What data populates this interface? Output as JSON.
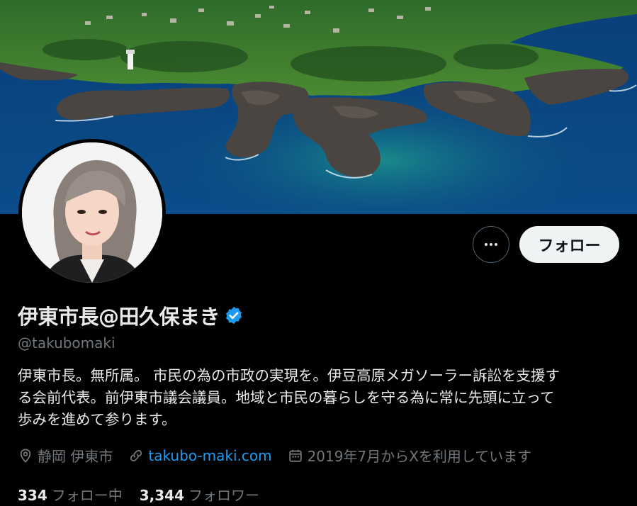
{
  "profile": {
    "display_name": "伊東市長@田久保まき",
    "handle": "@takubomaki",
    "bio_lines": [
      "伊東市長。無所属。 市民の為の市政の実現を。伊豆高原メガソーラー訴訟を支援す",
      "る会前代表。前伊東市議会議員。地域と市民の暮らしを守る為に常に先頭に立って",
      "歩みを進めて参ります。"
    ],
    "location": "静岡 伊東市",
    "website": "takubo-maki.com",
    "joined": "2019年7月からXを利用しています"
  },
  "stats": {
    "following_count": "334",
    "following_label": "フォロー中",
    "followers_count": "3,344",
    "followers_label": "フォロワー"
  },
  "actions": {
    "follow_label": "フォロー",
    "more_icon": "more-icon"
  },
  "colors": {
    "background": "#000000",
    "text_primary": "#e7e9ea",
    "text_secondary": "#71767b",
    "link": "#1d9bf0",
    "verified": "#1d9bf0",
    "button_bg": "#eff3f4"
  }
}
